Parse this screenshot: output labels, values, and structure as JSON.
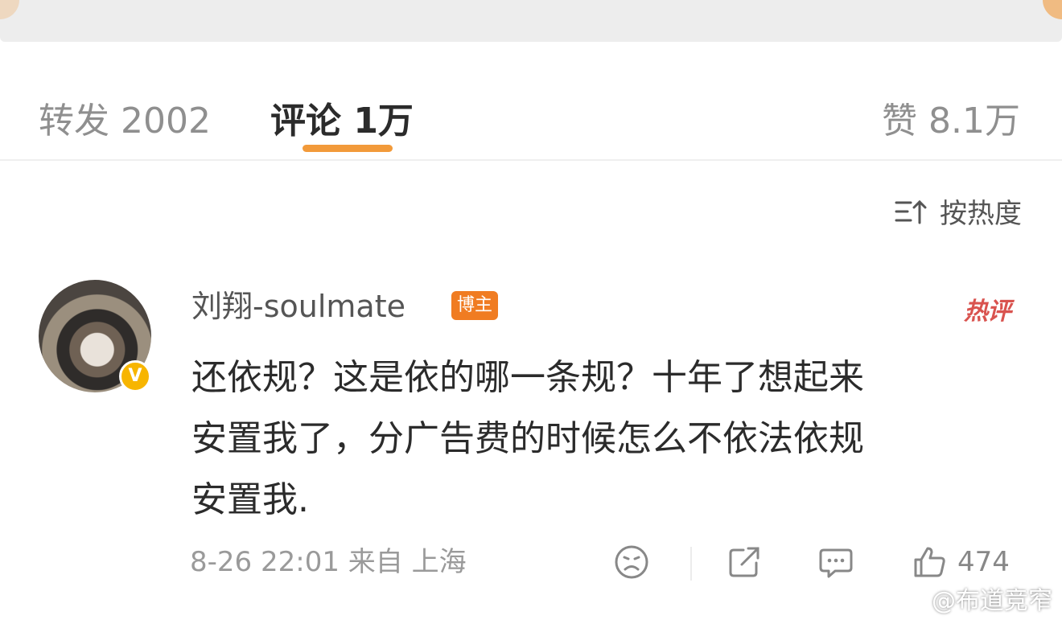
{
  "tabs": {
    "repost": "转发 2002",
    "comment": "评论 1万",
    "like": "赞 8.1万"
  },
  "sort": {
    "label": "按热度"
  },
  "comment": {
    "username": "刘翔-soulmate",
    "badge": "博主",
    "hot_tag": "热评",
    "verified_mark": "V",
    "lines": [
      "还依规？这是依的哪一条规？十年了想起来",
      "安置我了，分广告费的时候怎么不依法依规",
      "安置我."
    ],
    "meta": "8-26 22:01 来自 上海",
    "like_count": "474"
  },
  "watermark": "@布道竞窄",
  "colors": {
    "accent": "#f29a3a",
    "badge": "#f07c22",
    "verified": "#f7b500",
    "hot": "#d9534f"
  }
}
